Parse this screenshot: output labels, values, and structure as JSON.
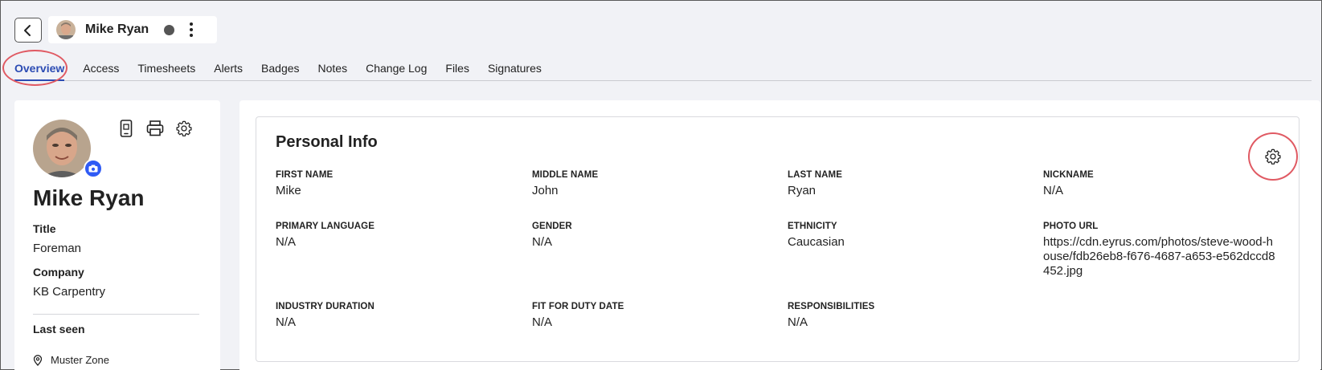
{
  "header": {
    "user_name": "Mike Ryan"
  },
  "tabs": [
    {
      "label": "Overview",
      "active": true
    },
    {
      "label": "Access"
    },
    {
      "label": "Timesheets"
    },
    {
      "label": "Alerts"
    },
    {
      "label": "Badges"
    },
    {
      "label": "Notes"
    },
    {
      "label": "Change Log"
    },
    {
      "label": "Files"
    },
    {
      "label": "Signatures"
    }
  ],
  "profile": {
    "name": "Mike Ryan",
    "title_label": "Title",
    "title_value": "Foreman",
    "company_label": "Company",
    "company_value": "KB Carpentry",
    "last_seen_label": "Last seen",
    "last_seen_value": "Muster Zone"
  },
  "personal_info": {
    "title": "Personal Info",
    "fields": [
      {
        "label": "FIRST NAME",
        "value": "Mike"
      },
      {
        "label": "MIDDLE NAME",
        "value": "John"
      },
      {
        "label": "LAST NAME",
        "value": "Ryan"
      },
      {
        "label": "NICKNAME",
        "value": "N/A"
      },
      {
        "label": "PRIMARY LANGUAGE",
        "value": "N/A"
      },
      {
        "label": "GENDER",
        "value": "N/A"
      },
      {
        "label": "ETHNICITY",
        "value": "Caucasian"
      },
      {
        "label": "PHOTO URL",
        "value": "https://cdn.eyrus.com/photos/steve-wood-house/fdb26eb8-f676-4687-a653-e562dccd8452.jpg"
      },
      {
        "label": "INDUSTRY DURATION",
        "value": "N/A"
      },
      {
        "label": "FIT FOR DUTY DATE",
        "value": "N/A"
      },
      {
        "label": "RESPONSIBILITIES",
        "value": "N/A"
      }
    ]
  },
  "colors": {
    "accent": "#2b4bb3",
    "highlight": "#e05a63",
    "camera_badge": "#2f5bf5",
    "background": "#f1f2f6"
  },
  "icons": {
    "back": "chevron-left-icon",
    "menu": "kebab-menu-icon",
    "mobile": "mobile-phone-icon",
    "print": "printer-icon",
    "settings": "gear-icon",
    "camera": "camera-icon",
    "location": "location-pin-icon"
  }
}
